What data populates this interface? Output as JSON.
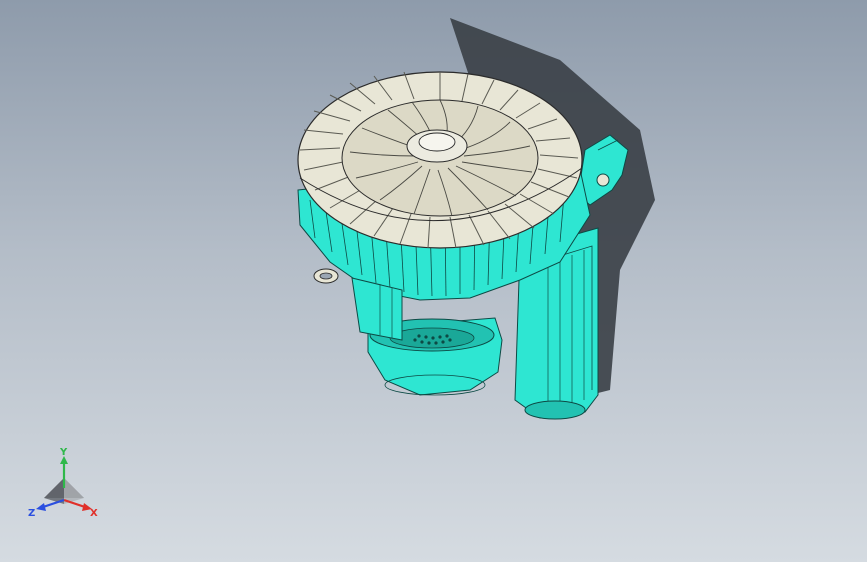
{
  "viewport": {
    "background_top": "#8e9bab",
    "background_bottom": "#d5dbe1"
  },
  "model": {
    "body_color": "#2ee6d2",
    "fan_color": "#e8e6d6",
    "shadow_color": "#3a3f46"
  },
  "triad": {
    "x_label": "X",
    "y_label": "Y",
    "z_label": "Z",
    "x_color": "#e0302a",
    "y_color": "#2fb84a",
    "z_color": "#2a4fe0"
  }
}
